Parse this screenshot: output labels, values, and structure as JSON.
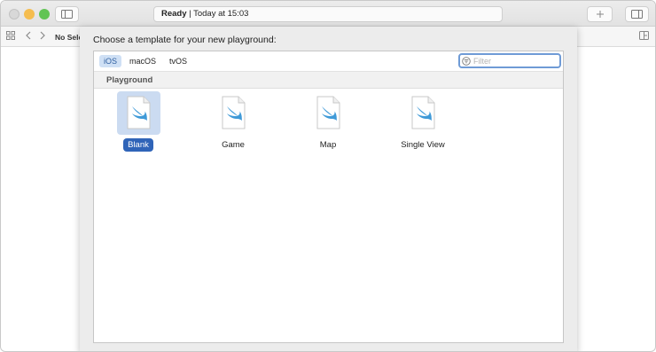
{
  "titlebar": {
    "activity_status": "Ready",
    "activity_separator": "|",
    "activity_time": "Today at 15:03"
  },
  "navbar": {
    "no_selection": "No Sele"
  },
  "sheet": {
    "title": "Choose a template for your new playground:",
    "platforms": [
      {
        "label": "iOS",
        "active": true
      },
      {
        "label": "macOS",
        "active": false
      },
      {
        "label": "tvOS",
        "active": false
      }
    ],
    "filter_placeholder": "Filter",
    "filter_value": "",
    "section_title": "Playground",
    "templates": [
      {
        "label": "Blank",
        "selected": true
      },
      {
        "label": "Game",
        "selected": false
      },
      {
        "label": "Map",
        "selected": false
      },
      {
        "label": "Single View",
        "selected": false
      }
    ]
  },
  "colors": {
    "accent": "#2f64b8",
    "selection_highlight": "#cbdbf1",
    "swift_bird": "#3f9ad8"
  },
  "icons": [
    "sidebar-toggle-icon",
    "add-icon",
    "inspector-toggle-icon",
    "grid-icon",
    "back-icon",
    "forward-icon",
    "filter-icon",
    "swift-file-icon"
  ]
}
